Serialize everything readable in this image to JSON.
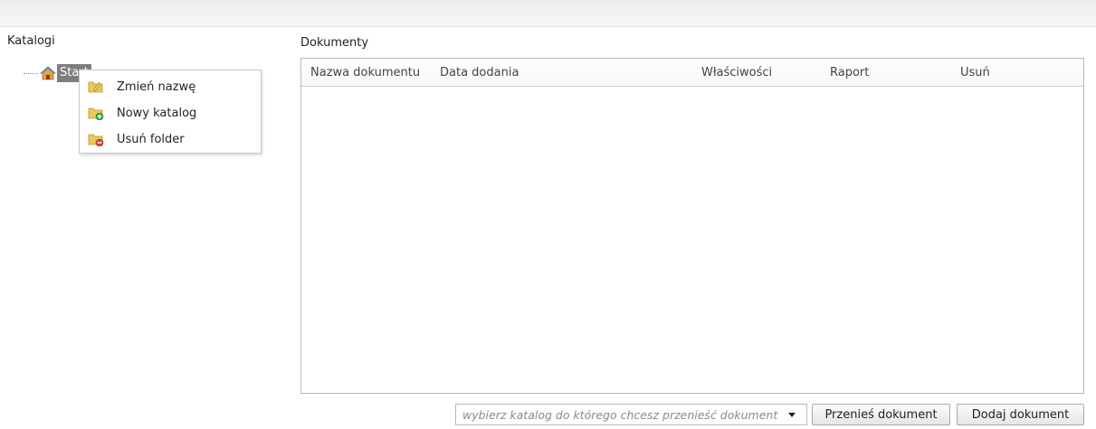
{
  "catalogs": {
    "title": "Katalogi",
    "tree_root_label": "Start",
    "tree_root_icon": "home-icon",
    "context_menu": [
      {
        "label": "Zmień nazwę",
        "icon": "rename-folder-icon"
      },
      {
        "label": "Nowy katalog",
        "icon": "new-folder-icon"
      },
      {
        "label": "Usuń folder",
        "icon": "delete-folder-icon"
      }
    ]
  },
  "documents": {
    "title": "Dokumenty",
    "columns": [
      "Nazwa dokumentu",
      "Data dodania",
      "Właściwości",
      "Raport",
      "Usuń"
    ],
    "rows": []
  },
  "footer": {
    "move_select_placeholder": "wybierz katalog do którego chcesz przenieść dokument",
    "move_button": "Przenieś dokument",
    "add_button": "Dodaj dokument"
  },
  "colors": {
    "selected_tree_bg": "#7e7e7e",
    "folder_yellow": "#e8c95a",
    "add_green": "#3aa53a",
    "delete_red": "#d9482b",
    "home_orange": "#e8a23a"
  }
}
